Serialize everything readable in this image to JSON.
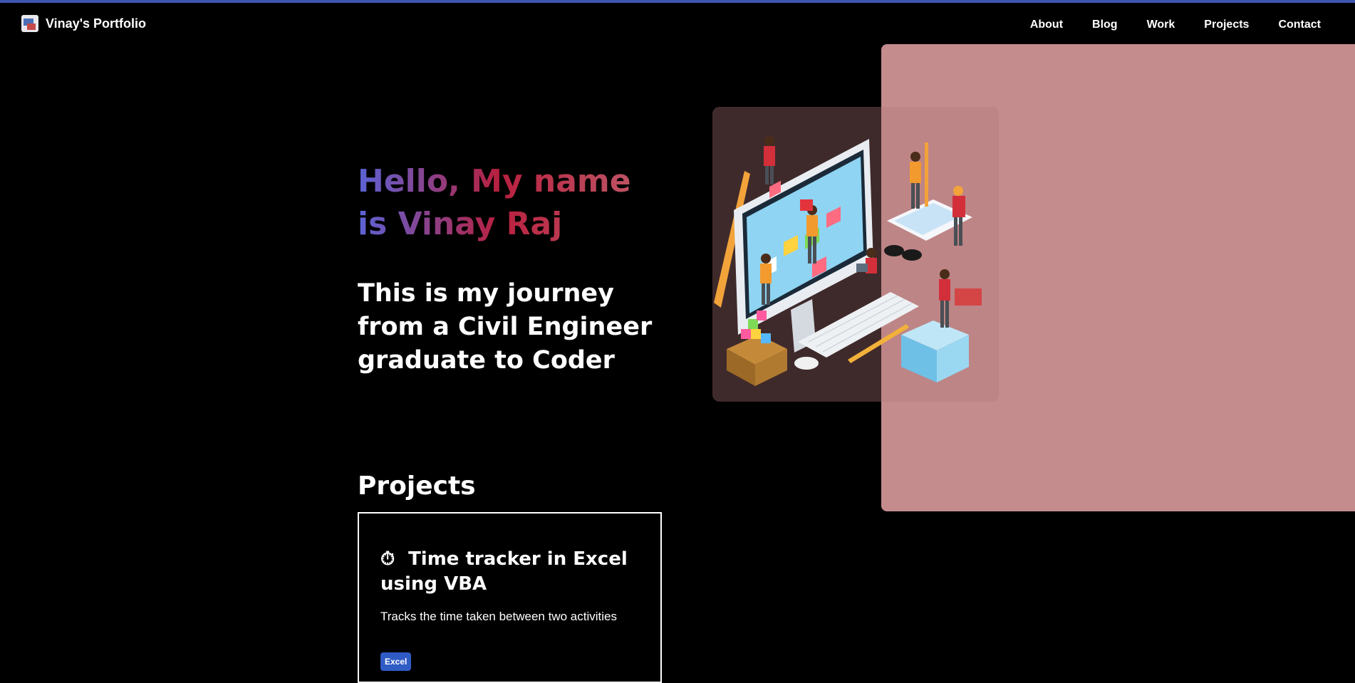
{
  "nav": {
    "brand_title": "Vinay's Portfolio",
    "links": [
      "About",
      "Blog",
      "Work",
      "Projects",
      "Contact"
    ]
  },
  "hero": {
    "greeting": "Hello, My name is Vinay Raj",
    "subtitle": "This is my journey from a Civil Engineer graduate to Coder"
  },
  "projects": {
    "section_title": "Projects",
    "items": [
      {
        "icon": "stopwatch-icon",
        "title": "Time tracker in Excel using VBA",
        "description": "Tracks the time taken between two activities",
        "tag": "Excel"
      }
    ]
  },
  "colors": {
    "accent_line": "#3d57b0",
    "panel": "#c48c8d",
    "gradient": [
      "#5b63d6",
      "#b8203f",
      "#c0636e"
    ],
    "tag": "#2f5bc4"
  }
}
